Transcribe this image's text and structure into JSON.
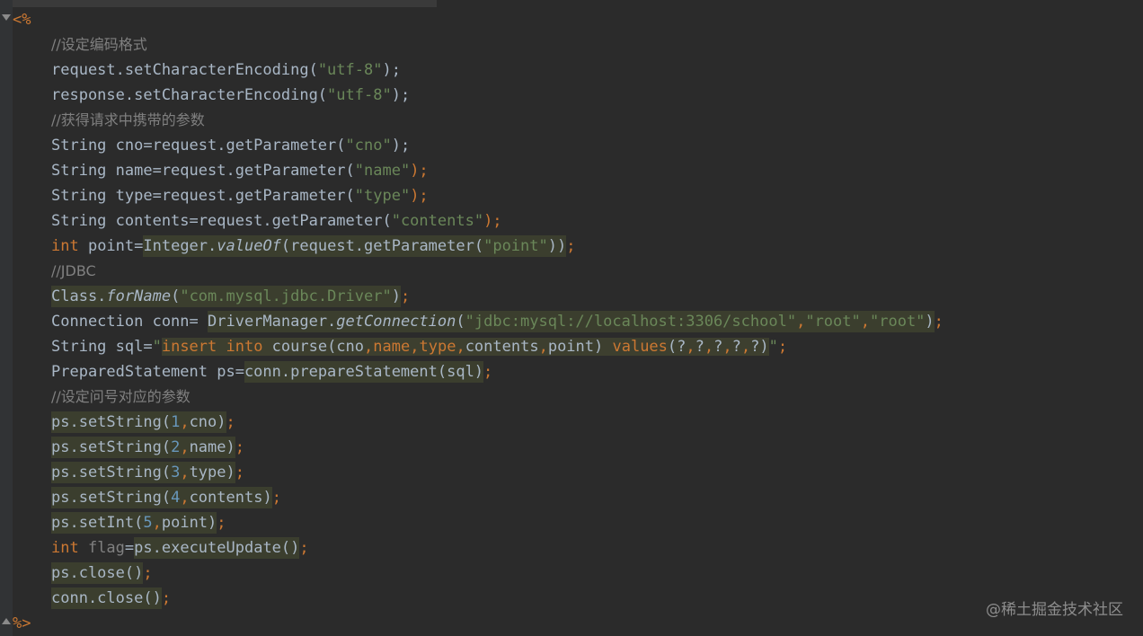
{
  "editor": {
    "jsp_open": "<%",
    "jsp_close": "%>",
    "watermark": "@稀土掘金技术社区"
  },
  "lines": {
    "c1": "//设定编码格式",
    "l1a": "request.setCharacterEncoding(",
    "l1s": "\"utf-8\"",
    "l1e": ");",
    "l2a": "response.setCharacterEncoding(",
    "l2s": "\"utf-8\"",
    "l2e": ");",
    "c2": "//获得请求中携带的参数",
    "l3a": "String cno=request.getParameter(",
    "l3s": "\"cno\"",
    "l3e": ");",
    "l4a": "String name=request.getParameter(",
    "l4s": "\"name\"",
    "l4e": ");",
    "l5a": "String type=request.getParameter(",
    "l5s": "\"type\"",
    "l5e": ");",
    "l6a": "String contents=request.getParameter(",
    "l6s": "\"contents\"",
    "l6e": ");",
    "l7k": "int",
    "l7a": " point=",
    "l7b": "Integer.",
    "l7m": "valueOf",
    "l7c": "(request.getParameter(",
    "l7s": "\"point\"",
    "l7d": "))",
    "l7e": ";",
    "c3": "//JDBC",
    "l8a": "Class.",
    "l8m": "forName",
    "l8b": "(",
    "l8s": "\"com.mysql.jdbc.Driver\"",
    "l8c": ")",
    "l8e": ";",
    "l9a": "Connection conn= ",
    "l9b": "DriverManager.",
    "l9m": "getConnection",
    "l9c": "(",
    "l9s1": "\"jdbc:mysql://localhost:3306/school\"",
    "l9p1": ",",
    "l9s2": "\"root\"",
    "l9p2": ",",
    "l9s3": "\"root\"",
    "l9d": ")",
    "l9e": ";",
    "l10a": "String sql=",
    "l10q1": "\"",
    "l10k1": "insert into",
    "l10b": " course(cno",
    "l10c1": ",",
    "l10n": "name",
    "l10c2": ",",
    "l10t": "type",
    "l10c3": ",",
    "l10r": "contents",
    "l10c4": ",",
    "l10p": "point) ",
    "l10k2": "values",
    "l10v": "(?",
    "l10v1": ",",
    "l10v2": "?",
    "l10v3": ",",
    "l10v4": "?",
    "l10v5": ",",
    "l10v6": "?",
    "l10v7": ",",
    "l10v8": "?)",
    "l10q2": "\"",
    "l10e": ";",
    "l11a": "PreparedStatement ps=",
    "l11b": "conn.prepareStatement(sql)",
    "l11e": ";",
    "c4": "//设定问号对应的参数",
    "l12a": "ps.setString(",
    "l12n": "1",
    "l12c": ",",
    "l12b": "cno)",
    "l12e": ";",
    "l13a": "ps.setString(",
    "l13n": "2",
    "l13c": ",",
    "l13b": "name)",
    "l13e": ";",
    "l14a": "ps.setString(",
    "l14n": "3",
    "l14c": ",",
    "l14b": "type)",
    "l14e": ";",
    "l15a": "ps.setString(",
    "l15n": "4",
    "l15c": ",",
    "l15b": "contents)",
    "l15e": ";",
    "l16a": "ps.setInt(",
    "l16n": "5",
    "l16c": ",",
    "l16b": "point)",
    "l16e": ";",
    "l17k": "int",
    "l17v": " flag",
    "l17a": "=",
    "l17b": "ps.executeUpdate()",
    "l17e": ";",
    "l18b": "ps.close()",
    "l18e": ";",
    "l19b": "conn.close()",
    "l19e": ";"
  },
  "colors": {
    "background": "#2b2b2b",
    "keyword": "#cc7832",
    "string": "#6a8759",
    "number": "#6897bb",
    "comment": "#808080",
    "text": "#a9b7c6",
    "highlight": "#3b3e2e"
  }
}
